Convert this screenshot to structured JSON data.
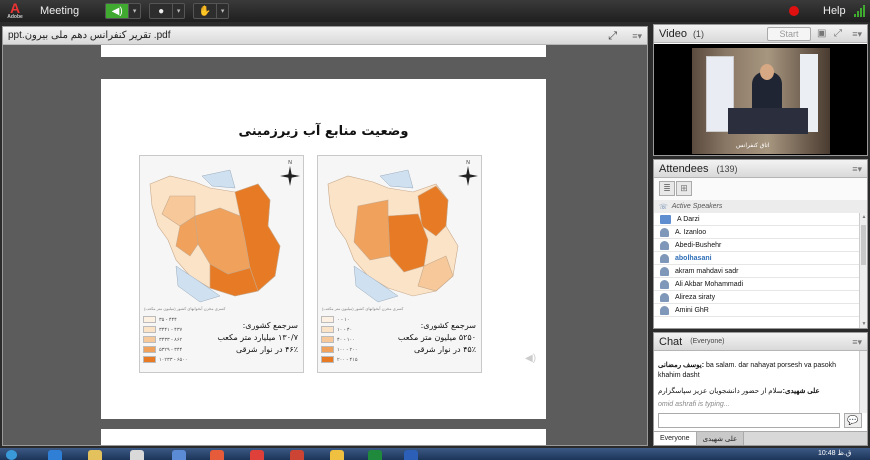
{
  "topbar": {
    "logo_text": "A",
    "logo_subtext": "Adobe",
    "menu_meeting": "Meeting",
    "help": "Help",
    "speaker_icon": "speaker-icon",
    "camera_icon": "webcam-icon",
    "raise_hand_icon": "raise-hand-icon",
    "dropdown_glyph": "▾"
  },
  "share": {
    "filename": "ppt.تقریر کنفرانس دهم ملی بیرون .pdf",
    "slide": {
      "title": "وضعیت منابع آب زیرزمینی",
      "map_left": {
        "caption": [
          "سرجمع کشوری:",
          "۱۳۰/۷ میلیارد متر مکعب",
          "۴۶٪ در نوار شرقی"
        ],
        "subcaption": "کسری مخزن آبخوانهای کشور (میلیون متر مکعب)",
        "legend": [
          "۳۵ - ۴۴۴",
          "۳۴۴۱ - ۴۳۷",
          "۳۴۳۳ - ۸۶۲",
          "۵۳۲۹ - ۳۴۴",
          "۱۰۲۳۳ - ۶۵۰۰"
        ]
      },
      "map_right": {
        "caption": [
          "سرجمع کشوری:",
          "۵۲۵۰ میلیون متر مکعب",
          "۴۵٪ در نوار شرقی"
        ],
        "subcaption": "کسری مخزن آبخوانهای کشور (میلیون متر مکعب)",
        "legend": [
          "۰ - ۱۰",
          "۱۰ - ۴۰",
          "۴۰ - ۱۰۰",
          "۱۰۰ - ۲۰۰",
          "۲۰۰ - ۴۱۵"
        ]
      },
      "north_label": "N"
    }
  },
  "video": {
    "title": "Video",
    "count": "(1)",
    "start_label": "Start",
    "label": "اتاق کنفرانس"
  },
  "attendees": {
    "title": "Attendees",
    "count": "(139)",
    "section": "Active Speakers",
    "items": [
      "A Darzi",
      "A. Izanloo",
      "Abedi-Bushehr",
      "abolhasani",
      "akram mahdavi sadr",
      "Ali Akbar Mohammadi",
      "Alireza siraty",
      "Amini GhR"
    ]
  },
  "chat": {
    "title": "Chat",
    "count": "(Everyone)",
    "messages": [
      {
        "who": "یوسف رمضانی:",
        "text": " ba salam. dar nahayat porsesh va pasokh khahim dasht"
      },
      {
        "who": "علی شهیدی:",
        "text": "سلام از حضور دانشجویان عزیز سپاسگزارم"
      }
    ],
    "typing": "omid ashrafi is typing...",
    "tab_everyone": "Everyone",
    "tab_other": "علی شهیدی"
  },
  "taskbar": {
    "clock": "10:48 ق.ظ"
  },
  "colors": {
    "accent_green": "#3faa2f",
    "record_red": "#e01010",
    "map_dark": "#e77b25",
    "map_mid": "#f0a15c",
    "map_light": "#f7c99a",
    "map_pale": "#fbe3c8",
    "map_blue": "#cfe1f0"
  }
}
